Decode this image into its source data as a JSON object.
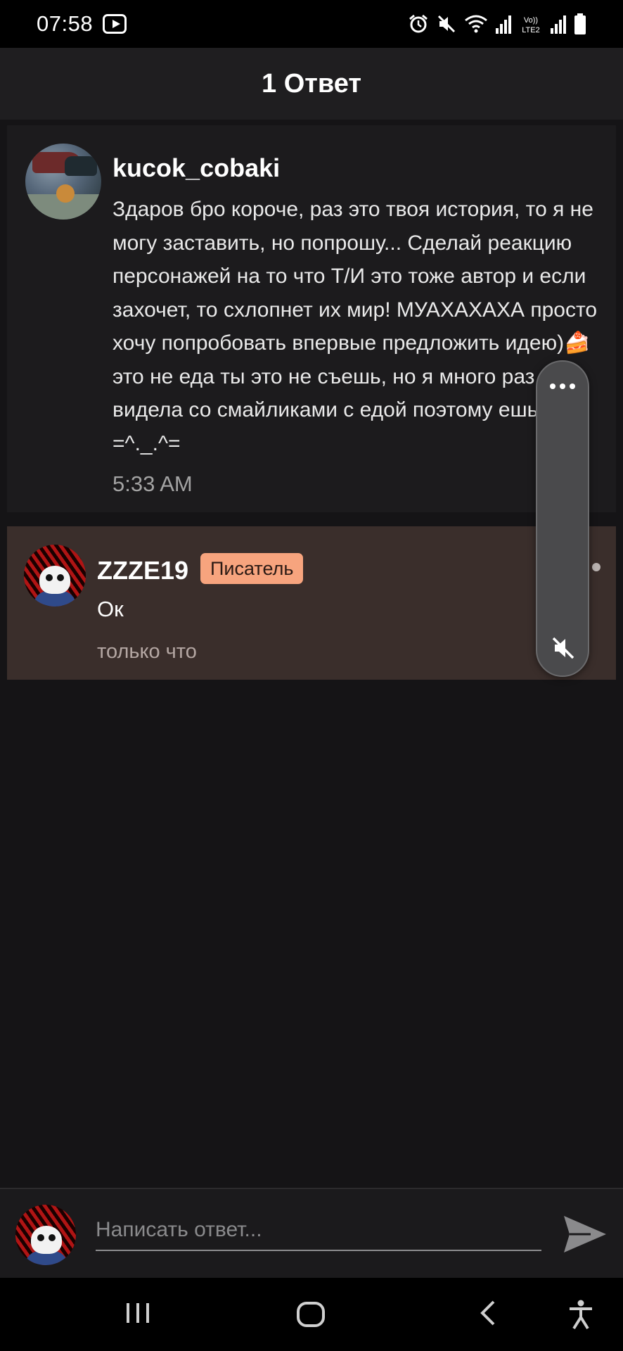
{
  "status_bar": {
    "time": "07:58",
    "icons": [
      "youtube-icon",
      "alarm-icon",
      "mute-icon",
      "wifi-icon",
      "signal-icon",
      "volte-lte2-icon",
      "signal-icon",
      "battery-icon"
    ]
  },
  "header": {
    "title": "1 Ответ"
  },
  "comment": {
    "username": "kucok_cobaki",
    "text": "Здаров бро короче, раз это твоя история, то я не могу заставить, но попрошу... Сделай реакцию персонажей на то что Т/И это тоже автор и если захочет, то схлопнет их мир! МУАХАХАХА просто хочу попробовать впервые предложить идею)🍰 это не еда ты это не съешь, но я много раз видела со смайликами с едой поэтому ешь =^._.^=",
    "time": "5:33 AM"
  },
  "reply": {
    "username": "ZZZE19",
    "badge": "Писатель",
    "text": "Ок",
    "time": "только что",
    "accent": "#f7a47e"
  },
  "input": {
    "placeholder": "Написать ответ..."
  },
  "nav": {
    "icons": [
      "recent-apps-icon",
      "home-icon",
      "back-icon",
      "accessibility-icon"
    ]
  }
}
